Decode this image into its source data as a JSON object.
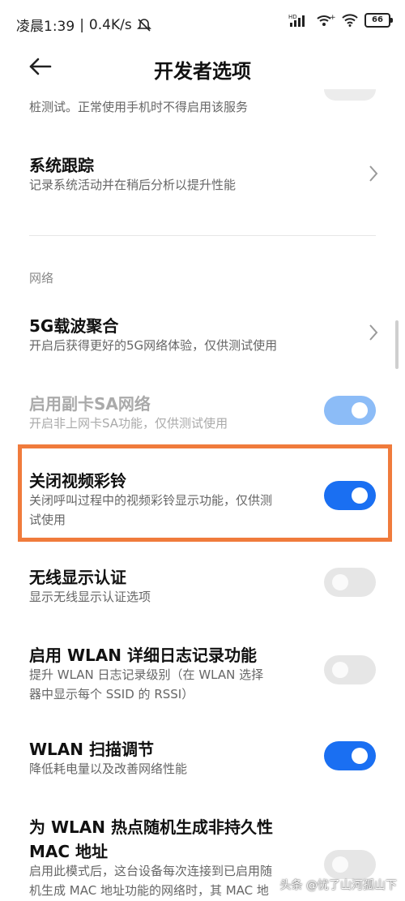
{
  "status_bar": {
    "time": "凌晨1:39",
    "speed": "0.4K/s",
    "battery": "66"
  },
  "header": {
    "title": "开发者选项"
  },
  "items": {
    "partial_desc": "桩测试。正常使用手机时不得启用该服务",
    "system_trace": {
      "title": "系统跟踪",
      "desc": "记录系统活动并在稍后分析以提升性能"
    },
    "section_network": "网络",
    "carrier_aggregation": {
      "title": "5G载波聚合",
      "desc": "开启后获得更好的5G网络体验，仅供测试使用"
    },
    "sub_sa": {
      "title": "启用副卡SA网络",
      "desc": "开启非上网卡SA功能，仅供测试使用",
      "state": "on",
      "enabled": false
    },
    "video_ringtone": {
      "title": "关闭视频彩铃",
      "desc_line1": "关闭呼叫过程中的视频彩铃显示功能，仅供测",
      "desc_line2": "试使用",
      "state": "on"
    },
    "wireless_display": {
      "title": "无线显示认证",
      "desc": "显示无线显示认证选项",
      "state": "off"
    },
    "wlan_verbose": {
      "title": "启用 WLAN 详细日志记录功能",
      "desc_line1": "提升 WLAN 日志记录级别（在 WLAN 选择",
      "desc_line2": "器中显示每个 SSID 的 RSSI）",
      "state": "off"
    },
    "wlan_scan": {
      "title": "WLAN 扫描调节",
      "desc": "降低耗电量以及改善网络性能",
      "state": "on"
    },
    "wlan_mac": {
      "title_line1": "为 WLAN 热点随机生成非持久性",
      "title_line2": "MAC 地址",
      "desc_line1": "启用此模式后，这台设备每次连接到已启用随",
      "desc_line2": "机生成 MAC 地址功能的网络时，其 MAC 地",
      "state": "off"
    }
  },
  "watermark": "头条 @忧了山河孤山下",
  "colors": {
    "accent": "#1a6ff2",
    "highlight_border": "#f07b3c"
  }
}
